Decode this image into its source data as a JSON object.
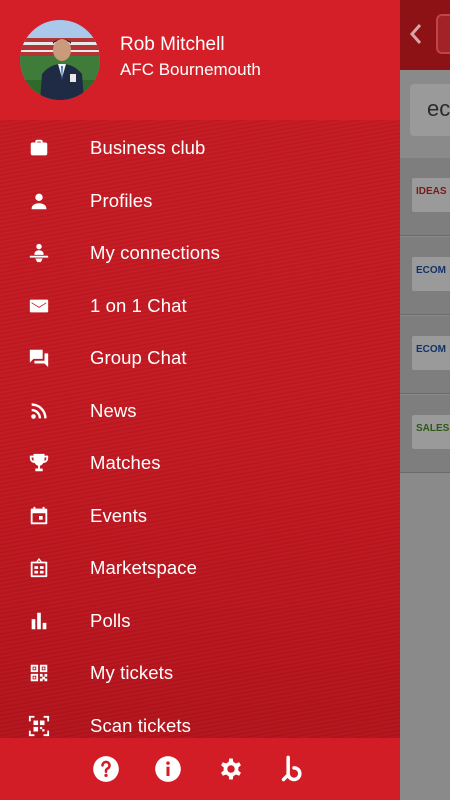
{
  "user": {
    "name": "Rob Mitchell",
    "club": "AFC Bournemouth"
  },
  "menu": {
    "items": [
      {
        "label": "Business club",
        "icon": "briefcase-icon"
      },
      {
        "label": "Profiles",
        "icon": "person-icon"
      },
      {
        "label": "My connections",
        "icon": "connections-icon"
      },
      {
        "label": "1 on 1 Chat",
        "icon": "mail-icon"
      },
      {
        "label": "Group Chat",
        "icon": "forum-icon"
      },
      {
        "label": "News",
        "icon": "rss-icon"
      },
      {
        "label": "Matches",
        "icon": "trophy-icon"
      },
      {
        "label": "Events",
        "icon": "calendar-icon"
      },
      {
        "label": "Marketspace",
        "icon": "store-icon"
      },
      {
        "label": "Polls",
        "icon": "bar-chart-icon"
      },
      {
        "label": "My tickets",
        "icon": "qr-code-icon"
      },
      {
        "label": "Scan tickets",
        "icon": "qr-scan-icon"
      }
    ]
  },
  "footer": {
    "buttons": [
      {
        "icon": "help-icon"
      },
      {
        "icon": "info-icon"
      },
      {
        "icon": "settings-icon"
      },
      {
        "icon": "brand-b-icon"
      }
    ]
  },
  "background": {
    "search_text": "ec",
    "rows": [
      "IDEAS",
      "ECOM",
      "ECOM",
      "SALES"
    ]
  },
  "colors": {
    "header": "#d51f28",
    "drawer": "#c31922",
    "footer": "#d21d26",
    "text": "#ffffff"
  }
}
